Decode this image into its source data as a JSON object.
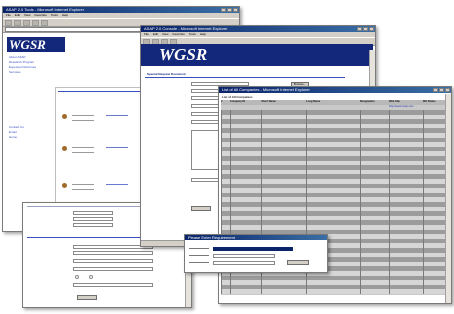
{
  "windows": {
    "back_left": {
      "title": "ASAP 2.0 Tools - Microsoft Internet Explorer",
      "logo": "WGSR",
      "sidebar_links": [
        "About ASAP",
        "Research Program",
        "Expected Outcomes",
        "Services",
        "Contact Us",
        "Email",
        "Home"
      ]
    },
    "middle": {
      "title": "ASAP 2.0 Console - Microsoft Internet Explorer",
      "logo": "WGSR",
      "section_title": "Special Request Document",
      "browse_label": "Browse..."
    },
    "table": {
      "title": "List of All Companies - Microsoft Internet Explorer",
      "heading": "List of All Companies",
      "columns": [
        "#",
        "Company ID",
        "Short Name",
        "Long Name",
        "Designation",
        "Web Site",
        "WO Status"
      ],
      "first_website": "http://www.comp.com"
    },
    "dialog": {
      "title": "Please Enter Requirement",
      "button_label": "Submit"
    }
  },
  "menu_items": [
    "File",
    "Edit",
    "View",
    "Favorites",
    "Tools",
    "Help"
  ]
}
